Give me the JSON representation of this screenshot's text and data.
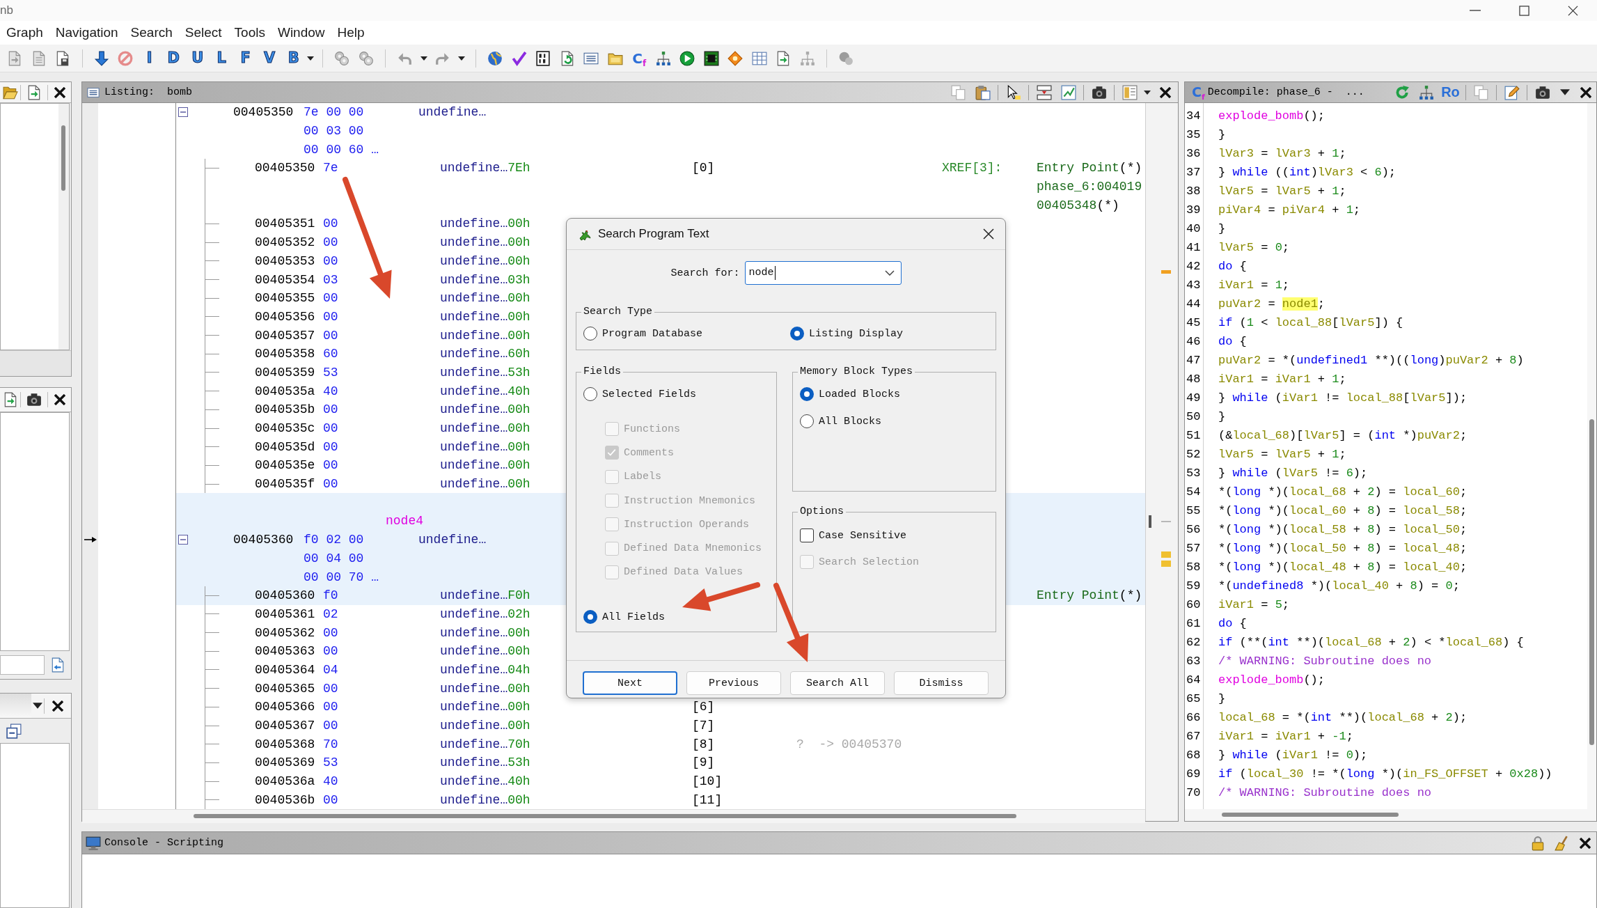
{
  "window": {
    "title": "nb"
  },
  "menu": [
    "Graph",
    "Navigation",
    "Search",
    "Select",
    "Tools",
    "Window",
    "Help"
  ],
  "toolbar": {
    "letters": [
      "I",
      "D",
      "U",
      "L",
      "F",
      "V",
      "B"
    ],
    "decompile_glyph": {
      "main": "C",
      "sub": "f"
    }
  },
  "listing": {
    "title": "Listing:  bomb",
    "rows": [
      {
        "kind": "struct",
        "selected": false,
        "cursor": false,
        "expanded": true,
        "address": "00405350",
        "bytes": "7e 00 00",
        "mnemonic": "undefine…"
      },
      {
        "kind": "bytes",
        "selected": false,
        "cursor": false,
        "bytes": "00 03 00"
      },
      {
        "kind": "bytes",
        "selected": false,
        "cursor": false,
        "bytes": "00 00 60 …"
      },
      {
        "kind": "element",
        "selected": false,
        "cursor": false,
        "address": "00405350",
        "byte": "7e",
        "mnemonic": "undefine…",
        "value": "7Eh",
        "index": "[0]",
        "xref": "XREF[3]:",
        "ref": "Entry Point",
        "ref_suffix": "(*)"
      },
      {
        "kind": "ref",
        "selected": false,
        "cursor": false,
        "ref": "phase_6:004019"
      },
      {
        "kind": "ref",
        "selected": false,
        "cursor": false,
        "ref": "00405348",
        "ref_suffix": "(*)"
      },
      {
        "kind": "element",
        "selected": false,
        "cursor": false,
        "address": "00405351",
        "byte": "00",
        "mnemonic": "undefine…",
        "value": "00h"
      },
      {
        "kind": "element",
        "selected": false,
        "cursor": false,
        "address": "00405352",
        "byte": "00",
        "mnemonic": "undefine…",
        "value": "00h"
      },
      {
        "kind": "element",
        "selected": false,
        "cursor": false,
        "address": "00405353",
        "byte": "00",
        "mnemonic": "undefine…",
        "value": "00h"
      },
      {
        "kind": "element",
        "selected": false,
        "cursor": false,
        "address": "00405354",
        "byte": "03",
        "mnemonic": "undefine…",
        "value": "03h"
      },
      {
        "kind": "element",
        "selected": false,
        "cursor": false,
        "address": "00405355",
        "byte": "00",
        "mnemonic": "undefine…",
        "value": "00h"
      },
      {
        "kind": "element",
        "selected": false,
        "cursor": false,
        "address": "00405356",
        "byte": "00",
        "mnemonic": "undefine…",
        "value": "00h"
      },
      {
        "kind": "element",
        "selected": false,
        "cursor": false,
        "address": "00405357",
        "byte": "00",
        "mnemonic": "undefine…",
        "value": "00h"
      },
      {
        "kind": "element",
        "selected": false,
        "cursor": false,
        "address": "00405358",
        "byte": "60",
        "mnemonic": "undefine…",
        "value": "60h"
      },
      {
        "kind": "element",
        "selected": false,
        "cursor": false,
        "address": "00405359",
        "byte": "53",
        "mnemonic": "undefine…",
        "value": "53h"
      },
      {
        "kind": "element",
        "selected": false,
        "cursor": false,
        "address": "0040535a",
        "byte": "40",
        "mnemonic": "undefine…",
        "value": "40h"
      },
      {
        "kind": "element",
        "selected": false,
        "cursor": false,
        "address": "0040535b",
        "byte": "00",
        "mnemonic": "undefine…",
        "value": "00h"
      },
      {
        "kind": "element",
        "selected": false,
        "cursor": false,
        "address": "0040535c",
        "byte": "00",
        "mnemonic": "undefine…",
        "value": "00h"
      },
      {
        "kind": "element",
        "selected": false,
        "cursor": false,
        "address": "0040535d",
        "byte": "00",
        "mnemonic": "undefine…",
        "value": "00h"
      },
      {
        "kind": "element",
        "selected": false,
        "cursor": false,
        "address": "0040535e",
        "byte": "00",
        "mnemonic": "undefine…",
        "value": "00h"
      },
      {
        "kind": "element",
        "selected": false,
        "cursor": false,
        "address": "0040535f",
        "byte": "00",
        "mnemonic": "undefine…",
        "value": "00h"
      },
      {
        "kind": "blank",
        "selected": true,
        "cursor": false
      },
      {
        "kind": "label",
        "selected": true,
        "cursor": false,
        "label": "node4"
      },
      {
        "kind": "struct",
        "selected": true,
        "cursor": true,
        "expanded": true,
        "address": "00405360",
        "bytes": "f0 02 00",
        "mnemonic": "undefine…"
      },
      {
        "kind": "bytes",
        "selected": true,
        "cursor": false,
        "bytes": "00 04 00"
      },
      {
        "kind": "bytes",
        "selected": true,
        "cursor": false,
        "bytes": "00 00 70 …"
      },
      {
        "kind": "element",
        "selected": true,
        "cursor": false,
        "address": "00405360",
        "byte": "f0",
        "mnemonic": "undefine…",
        "value": "F0h",
        "ref": "Entry Point",
        "ref_suffix": "(*)"
      },
      {
        "kind": "element",
        "selected": false,
        "cursor": false,
        "address": "00405361",
        "byte": "02",
        "mnemonic": "undefine…",
        "value": "02h"
      },
      {
        "kind": "element",
        "selected": false,
        "cursor": false,
        "address": "00405362",
        "byte": "00",
        "mnemonic": "undefine…",
        "value": "00h"
      },
      {
        "kind": "element",
        "selected": false,
        "cursor": false,
        "address": "00405363",
        "byte": "00",
        "mnemonic": "undefine…",
        "value": "00h"
      },
      {
        "kind": "element",
        "selected": false,
        "cursor": false,
        "address": "00405364",
        "byte": "04",
        "mnemonic": "undefine…",
        "value": "04h"
      },
      {
        "kind": "element",
        "selected": false,
        "cursor": false,
        "address": "00405365",
        "byte": "00",
        "mnemonic": "undefine…",
        "value": "00h"
      },
      {
        "kind": "element",
        "selected": false,
        "cursor": false,
        "address": "00405366",
        "byte": "00",
        "mnemonic": "undefine…",
        "value": "00h",
        "index": "[6]"
      },
      {
        "kind": "element",
        "selected": false,
        "cursor": false,
        "address": "00405367",
        "byte": "00",
        "mnemonic": "undefine…",
        "value": "00h",
        "index": "[7]"
      },
      {
        "kind": "element",
        "selected": false,
        "cursor": false,
        "address": "00405368",
        "byte": "70",
        "mnemonic": "undefine…",
        "value": "70h",
        "index": "[8]",
        "pointer": "?  -> 00405370"
      },
      {
        "kind": "element",
        "selected": false,
        "cursor": false,
        "address": "00405369",
        "byte": "53",
        "mnemonic": "undefine…",
        "value": "53h",
        "index": "[9]"
      },
      {
        "kind": "element",
        "selected": false,
        "cursor": false,
        "address": "0040536a",
        "byte": "40",
        "mnemonic": "undefine…",
        "value": "40h",
        "index": "[10]"
      },
      {
        "kind": "element",
        "selected": false,
        "cursor": false,
        "address": "0040536b",
        "byte": "00",
        "mnemonic": "undefine…",
        "value": "00h",
        "index": "[11]"
      }
    ]
  },
  "decompiler": {
    "glyph": {
      "main": "C",
      "sub": "f"
    },
    "title": "Decompile: phase_6 -  ...",
    "ro_label": "Ro",
    "lines": [
      {
        "number": "34",
        "tokens": [
          {
            "kind": "call",
            "text": "      explode_bomb"
          },
          {
            "kind": "plain",
            "text": "();"
          }
        ]
      },
      {
        "number": "35",
        "tokens": [
          {
            "kind": "plain",
            "text": "    }"
          }
        ]
      },
      {
        "number": "36",
        "tokens": [
          {
            "kind": "var",
            "text": "    lVar3"
          },
          {
            "kind": "plain",
            "text": " = "
          },
          {
            "kind": "var",
            "text": "lVar3"
          },
          {
            "kind": "plain",
            "text": " + "
          },
          {
            "kind": "number",
            "text": "1"
          },
          {
            "kind": "plain",
            "text": ";"
          }
        ]
      },
      {
        "number": "37",
        "tokens": [
          {
            "kind": "plain",
            "text": "  } "
          },
          {
            "kind": "keyword",
            "text": "while"
          },
          {
            "kind": "plain",
            "text": " (("
          },
          {
            "kind": "keyword",
            "text": "int"
          },
          {
            "kind": "plain",
            "text": ")"
          },
          {
            "kind": "var",
            "text": "lVar3"
          },
          {
            "kind": "plain",
            "text": " < "
          },
          {
            "kind": "number",
            "text": "6"
          },
          {
            "kind": "plain",
            "text": ");"
          }
        ]
      },
      {
        "number": "38",
        "tokens": [
          {
            "kind": "var",
            "text": "  lVar5"
          },
          {
            "kind": "plain",
            "text": " = "
          },
          {
            "kind": "var",
            "text": "lVar5"
          },
          {
            "kind": "plain",
            "text": " + "
          },
          {
            "kind": "number",
            "text": "1"
          },
          {
            "kind": "plain",
            "text": ";"
          }
        ]
      },
      {
        "number": "39",
        "tokens": [
          {
            "kind": "var",
            "text": "  piVar4"
          },
          {
            "kind": "plain",
            "text": " = "
          },
          {
            "kind": "var",
            "text": "piVar4"
          },
          {
            "kind": "plain",
            "text": " + "
          },
          {
            "kind": "number",
            "text": "1"
          },
          {
            "kind": "plain",
            "text": ";"
          }
        ]
      },
      {
        "number": "40",
        "tokens": [
          {
            "kind": "plain",
            "text": "}"
          }
        ]
      },
      {
        "number": "41",
        "tokens": [
          {
            "kind": "var",
            "text": "lVar5"
          },
          {
            "kind": "plain",
            "text": " = "
          },
          {
            "kind": "number",
            "text": "0"
          },
          {
            "kind": "plain",
            "text": ";"
          }
        ]
      },
      {
        "number": "42",
        "tokens": [
          {
            "kind": "keyword",
            "text": "do"
          },
          {
            "kind": "plain",
            "text": " {"
          }
        ]
      },
      {
        "number": "43",
        "tokens": [
          {
            "kind": "var",
            "text": "  iVar1"
          },
          {
            "kind": "plain",
            "text": " = "
          },
          {
            "kind": "number",
            "text": "1"
          },
          {
            "kind": "plain",
            "text": ";"
          }
        ]
      },
      {
        "number": "44",
        "tokens": [
          {
            "kind": "var",
            "text": "  puVar2"
          },
          {
            "kind": "plain",
            "text": " = "
          },
          {
            "kind": "match",
            "text": "node1"
          },
          {
            "kind": "plain",
            "text": ";"
          }
        ]
      },
      {
        "number": "45",
        "tokens": [
          {
            "kind": "keyword",
            "text": "  if"
          },
          {
            "kind": "plain",
            "text": " ("
          },
          {
            "kind": "number",
            "text": "1"
          },
          {
            "kind": "plain",
            "text": " < "
          },
          {
            "kind": "var",
            "text": "local_88"
          },
          {
            "kind": "plain",
            "text": "["
          },
          {
            "kind": "var",
            "text": "lVar5"
          },
          {
            "kind": "plain",
            "text": "]) {"
          }
        ]
      },
      {
        "number": "46",
        "tokens": [
          {
            "kind": "keyword",
            "text": "    do"
          },
          {
            "kind": "plain",
            "text": " {"
          }
        ]
      },
      {
        "number": "47",
        "tokens": [
          {
            "kind": "var",
            "text": "      puVar2"
          },
          {
            "kind": "plain",
            "text": " = *("
          },
          {
            "kind": "keyword",
            "text": "undefined1"
          },
          {
            "kind": "plain",
            "text": " **)(("
          },
          {
            "kind": "keyword",
            "text": "long"
          },
          {
            "kind": "plain",
            "text": ")"
          },
          {
            "kind": "var",
            "text": "puVar2"
          },
          {
            "kind": "plain",
            "text": " + "
          },
          {
            "kind": "number",
            "text": "8"
          },
          {
            "kind": "plain",
            "text": ")"
          }
        ]
      },
      {
        "number": "48",
        "tokens": [
          {
            "kind": "var",
            "text": "      iVar1"
          },
          {
            "kind": "plain",
            "text": " = "
          },
          {
            "kind": "var",
            "text": "iVar1"
          },
          {
            "kind": "plain",
            "text": " + "
          },
          {
            "kind": "number",
            "text": "1"
          },
          {
            "kind": "plain",
            "text": ";"
          }
        ]
      },
      {
        "number": "49",
        "tokens": [
          {
            "kind": "plain",
            "text": "    } "
          },
          {
            "kind": "keyword",
            "text": "while"
          },
          {
            "kind": "plain",
            "text": " ("
          },
          {
            "kind": "var",
            "text": "iVar1"
          },
          {
            "kind": "plain",
            "text": " != "
          },
          {
            "kind": "var",
            "text": "local_88"
          },
          {
            "kind": "plain",
            "text": "["
          },
          {
            "kind": "var",
            "text": "lVar5"
          },
          {
            "kind": "plain",
            "text": "]);"
          }
        ]
      },
      {
        "number": "50",
        "tokens": [
          {
            "kind": "plain",
            "text": "  }"
          }
        ]
      },
      {
        "number": "51",
        "tokens": [
          {
            "kind": "plain",
            "text": "  (&"
          },
          {
            "kind": "var",
            "text": "local_68"
          },
          {
            "kind": "plain",
            "text": ")["
          },
          {
            "kind": "var",
            "text": "lVar5"
          },
          {
            "kind": "plain",
            "text": "] = ("
          },
          {
            "kind": "keyword",
            "text": "int"
          },
          {
            "kind": "plain",
            "text": " *)"
          },
          {
            "kind": "var",
            "text": "puVar2"
          },
          {
            "kind": "plain",
            "text": ";"
          }
        ]
      },
      {
        "number": "52",
        "tokens": [
          {
            "kind": "var",
            "text": "  lVar5"
          },
          {
            "kind": "plain",
            "text": " = "
          },
          {
            "kind": "var",
            "text": "lVar5"
          },
          {
            "kind": "plain",
            "text": " + "
          },
          {
            "kind": "number",
            "text": "1"
          },
          {
            "kind": "plain",
            "text": ";"
          }
        ]
      },
      {
        "number": "53",
        "tokens": [
          {
            "kind": "plain",
            "text": "} "
          },
          {
            "kind": "keyword",
            "text": "while"
          },
          {
            "kind": "plain",
            "text": " ("
          },
          {
            "kind": "var",
            "text": "lVar5"
          },
          {
            "kind": "plain",
            "text": " != "
          },
          {
            "kind": "number",
            "text": "6"
          },
          {
            "kind": "plain",
            "text": ");"
          }
        ]
      },
      {
        "number": "54",
        "tokens": [
          {
            "kind": "plain",
            "text": "*("
          },
          {
            "kind": "keyword",
            "text": "long"
          },
          {
            "kind": "plain",
            "text": " *)("
          },
          {
            "kind": "var",
            "text": "local_68"
          },
          {
            "kind": "plain",
            "text": " + "
          },
          {
            "kind": "number",
            "text": "2"
          },
          {
            "kind": "plain",
            "text": ") = "
          },
          {
            "kind": "var",
            "text": "local_60"
          },
          {
            "kind": "plain",
            "text": ";"
          }
        ]
      },
      {
        "number": "55",
        "tokens": [
          {
            "kind": "plain",
            "text": "*("
          },
          {
            "kind": "keyword",
            "text": "long"
          },
          {
            "kind": "plain",
            "text": " *)("
          },
          {
            "kind": "var",
            "text": "local_60"
          },
          {
            "kind": "plain",
            "text": " + "
          },
          {
            "kind": "number",
            "text": "8"
          },
          {
            "kind": "plain",
            "text": ") = "
          },
          {
            "kind": "var",
            "text": "local_58"
          },
          {
            "kind": "plain",
            "text": ";"
          }
        ]
      },
      {
        "number": "56",
        "tokens": [
          {
            "kind": "plain",
            "text": "*("
          },
          {
            "kind": "keyword",
            "text": "long"
          },
          {
            "kind": "plain",
            "text": " *)("
          },
          {
            "kind": "var",
            "text": "local_58"
          },
          {
            "kind": "plain",
            "text": " + "
          },
          {
            "kind": "number",
            "text": "8"
          },
          {
            "kind": "plain",
            "text": ") = "
          },
          {
            "kind": "var",
            "text": "local_50"
          },
          {
            "kind": "plain",
            "text": ";"
          }
        ]
      },
      {
        "number": "57",
        "tokens": [
          {
            "kind": "plain",
            "text": "*("
          },
          {
            "kind": "keyword",
            "text": "long"
          },
          {
            "kind": "plain",
            "text": " *)("
          },
          {
            "kind": "var",
            "text": "local_50"
          },
          {
            "kind": "plain",
            "text": " + "
          },
          {
            "kind": "number",
            "text": "8"
          },
          {
            "kind": "plain",
            "text": ") = "
          },
          {
            "kind": "var",
            "text": "local_48"
          },
          {
            "kind": "plain",
            "text": ";"
          }
        ]
      },
      {
        "number": "58",
        "tokens": [
          {
            "kind": "plain",
            "text": "*("
          },
          {
            "kind": "keyword",
            "text": "long"
          },
          {
            "kind": "plain",
            "text": " *)("
          },
          {
            "kind": "var",
            "text": "local_48"
          },
          {
            "kind": "plain",
            "text": " + "
          },
          {
            "kind": "number",
            "text": "8"
          },
          {
            "kind": "plain",
            "text": ") = "
          },
          {
            "kind": "var",
            "text": "local_40"
          },
          {
            "kind": "plain",
            "text": ";"
          }
        ]
      },
      {
        "number": "59",
        "tokens": [
          {
            "kind": "plain",
            "text": "*("
          },
          {
            "kind": "keyword",
            "text": "undefined8"
          },
          {
            "kind": "plain",
            "text": " *)("
          },
          {
            "kind": "var",
            "text": "local_40"
          },
          {
            "kind": "plain",
            "text": " + "
          },
          {
            "kind": "number",
            "text": "8"
          },
          {
            "kind": "plain",
            "text": ") = "
          },
          {
            "kind": "number",
            "text": "0"
          },
          {
            "kind": "plain",
            "text": ";"
          }
        ]
      },
      {
        "number": "60",
        "tokens": [
          {
            "kind": "var",
            "text": "iVar1"
          },
          {
            "kind": "plain",
            "text": " = "
          },
          {
            "kind": "number",
            "text": "5"
          },
          {
            "kind": "plain",
            "text": ";"
          }
        ]
      },
      {
        "number": "61",
        "tokens": [
          {
            "kind": "keyword",
            "text": "do"
          },
          {
            "kind": "plain",
            "text": " {"
          }
        ]
      },
      {
        "number": "62",
        "tokens": [
          {
            "kind": "keyword",
            "text": "  if"
          },
          {
            "kind": "plain",
            "text": " (**("
          },
          {
            "kind": "keyword",
            "text": "int"
          },
          {
            "kind": "plain",
            "text": " **)("
          },
          {
            "kind": "var",
            "text": "local_68"
          },
          {
            "kind": "plain",
            "text": " + "
          },
          {
            "kind": "number",
            "text": "2"
          },
          {
            "kind": "plain",
            "text": ") < *"
          },
          {
            "kind": "var",
            "text": "local_68"
          },
          {
            "kind": "plain",
            "text": ") {"
          }
        ]
      },
      {
        "number": "63",
        "tokens": [
          {
            "kind": "comment",
            "text": "                  /* WARNING: Subroutine does no"
          }
        ]
      },
      {
        "number": "64",
        "tokens": [
          {
            "kind": "call",
            "text": "    explode_bomb"
          },
          {
            "kind": "plain",
            "text": "();"
          }
        ]
      },
      {
        "number": "65",
        "tokens": [
          {
            "kind": "plain",
            "text": "  }"
          }
        ]
      },
      {
        "number": "66",
        "tokens": [
          {
            "kind": "var",
            "text": "  local_68"
          },
          {
            "kind": "plain",
            "text": " = *("
          },
          {
            "kind": "keyword",
            "text": "int"
          },
          {
            "kind": "plain",
            "text": " **)("
          },
          {
            "kind": "var",
            "text": "local_68"
          },
          {
            "kind": "plain",
            "text": " + "
          },
          {
            "kind": "number",
            "text": "2"
          },
          {
            "kind": "plain",
            "text": ");"
          }
        ]
      },
      {
        "number": "67",
        "tokens": [
          {
            "kind": "var",
            "text": "  iVar1"
          },
          {
            "kind": "plain",
            "text": " = "
          },
          {
            "kind": "var",
            "text": "iVar1"
          },
          {
            "kind": "plain",
            "text": " + "
          },
          {
            "kind": "number",
            "text": "-1"
          },
          {
            "kind": "plain",
            "text": ";"
          }
        ]
      },
      {
        "number": "68",
        "tokens": [
          {
            "kind": "plain",
            "text": "} "
          },
          {
            "kind": "keyword",
            "text": "while"
          },
          {
            "kind": "plain",
            "text": " ("
          },
          {
            "kind": "var",
            "text": "iVar1"
          },
          {
            "kind": "plain",
            "text": " != "
          },
          {
            "kind": "number",
            "text": "0"
          },
          {
            "kind": "plain",
            "text": ");"
          }
        ]
      },
      {
        "number": "69",
        "tokens": [
          {
            "kind": "keyword",
            "text": "if"
          },
          {
            "kind": "plain",
            "text": " ("
          },
          {
            "kind": "var",
            "text": "local_30"
          },
          {
            "kind": "plain",
            "text": " != *("
          },
          {
            "kind": "keyword",
            "text": "long"
          },
          {
            "kind": "plain",
            "text": " *)("
          },
          {
            "kind": "var",
            "text": "in_FS_OFFSET"
          },
          {
            "kind": "plain",
            "text": " + "
          },
          {
            "kind": "number",
            "text": "0x28"
          },
          {
            "kind": "plain",
            "text": "))"
          }
        ]
      },
      {
        "number": "70",
        "tokens": [
          {
            "kind": "comment",
            "text": "                  /* WARNING: Subroutine does no"
          }
        ]
      }
    ]
  },
  "console": {
    "title": "Console - Scripting"
  },
  "dialog": {
    "title": "Search Program Text",
    "search_label": "Search for:",
    "search_value": "node",
    "search_type": {
      "title": "Search Type",
      "options": [
        {
          "label": "Program Database",
          "selected": false
        },
        {
          "label": "Listing Display",
          "selected": true
        }
      ]
    },
    "fields": {
      "title": "Fields",
      "items": [
        {
          "kind": "radio",
          "label": "Selected Fields",
          "selected": false
        },
        {
          "kind": "checkbox",
          "label": "Functions",
          "checked": false,
          "disabled": true
        },
        {
          "kind": "checkbox",
          "label": "Comments",
          "checked": true,
          "disabled": true
        },
        {
          "kind": "checkbox",
          "label": "Labels",
          "checked": false,
          "disabled": true
        },
        {
          "kind": "checkbox",
          "label": "Instruction Mnemonics",
          "checked": false,
          "disabled": true
        },
        {
          "kind": "checkbox",
          "label": "Instruction Operands",
          "checked": false,
          "disabled": true
        },
        {
          "kind": "checkbox",
          "label": "Defined Data Mnemonics",
          "checked": false,
          "disabled": true
        },
        {
          "kind": "checkbox",
          "label": "Defined Data Values",
          "checked": false,
          "disabled": true
        },
        {
          "kind": "radio",
          "label": "All Fields",
          "selected": true
        }
      ]
    },
    "memory_block_types": {
      "title": "Memory Block Types",
      "options": [
        {
          "label": "Loaded Blocks",
          "selected": true
        },
        {
          "label": "All Blocks",
          "selected": false
        }
      ]
    },
    "options": {
      "title": "Options",
      "items": [
        {
          "label": "Case Sensitive",
          "checked": false,
          "disabled": false
        },
        {
          "label": "Search Selection",
          "checked": false,
          "disabled": true
        }
      ]
    },
    "buttons": [
      {
        "label": "Next",
        "default": true
      },
      {
        "label": "Previous",
        "default": false
      },
      {
        "label": "Search All",
        "default": false
      },
      {
        "label": "Dismiss",
        "default": false
      }
    ]
  }
}
